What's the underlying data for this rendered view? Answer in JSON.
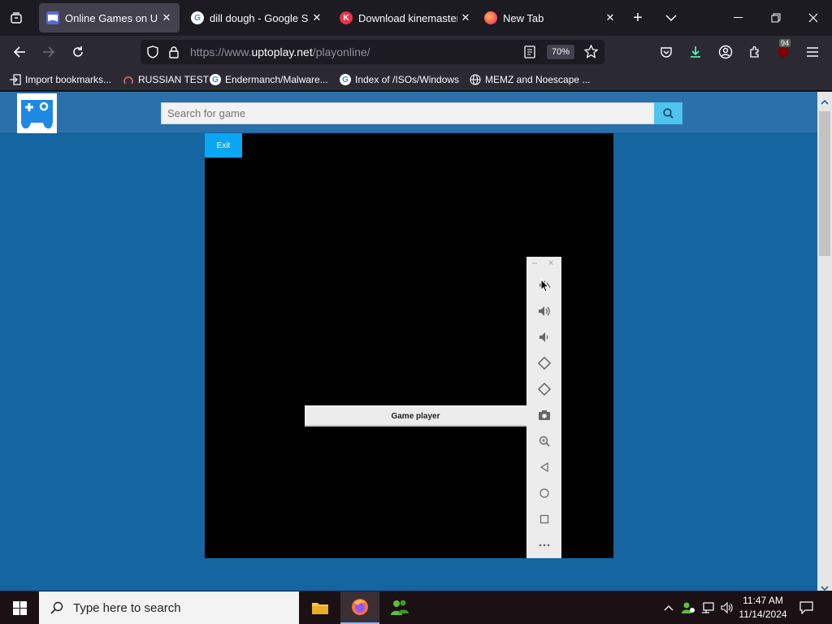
{
  "tabs": [
    {
      "title": "Online Games on Uptop",
      "active": true,
      "favicon": "uptoplay-icon"
    },
    {
      "title": "dill dough - Google Sea",
      "active": false,
      "favicon": "google-icon"
    },
    {
      "title": "Download kinemaster",
      "active": false,
      "favicon": "kinemaster-icon"
    },
    {
      "title": "New Tab",
      "active": false,
      "favicon": "firefox-icon"
    }
  ],
  "url": {
    "prefix": "https://www.",
    "domain": "uptoplay.net",
    "path": "/playonline/"
  },
  "zoom": "70%",
  "downloads_badge": "",
  "extension_badge": "94",
  "bookmarks": [
    {
      "label": "Import bookmarks...",
      "icon": "import-icon"
    },
    {
      "label": "RUSSIAN TEST",
      "icon": "russian-test-icon"
    },
    {
      "label": "Endermanch/Malware...",
      "icon": "google-icon"
    },
    {
      "label": "Index of /ISOs/Windows",
      "icon": "google-icon"
    },
    {
      "label": "MEMZ and Noescape ...",
      "icon": "globe-icon"
    }
  ],
  "site": {
    "search_placeholder": "Search for game",
    "exit_label": "Exit",
    "game_player_label": "Game player"
  },
  "side_panel": {
    "minimize": "–",
    "close": "×",
    "items": [
      "volume-mute-icon",
      "volume-up-icon",
      "volume-down-icon",
      "rotate-left-icon",
      "rotate-right-icon",
      "camera-icon",
      "zoom-icon",
      "back-icon",
      "home-icon",
      "recents-icon",
      "more-icon"
    ]
  },
  "taskbar": {
    "search_placeholder": "Type here to search",
    "time": "11:47 AM",
    "date": "11/14/2024"
  },
  "colors": {
    "page_bg": "#1565a1",
    "header_bg": "#2b70ab",
    "exit_button": "#0aa6f4",
    "search_button": "#4ec3ef"
  }
}
